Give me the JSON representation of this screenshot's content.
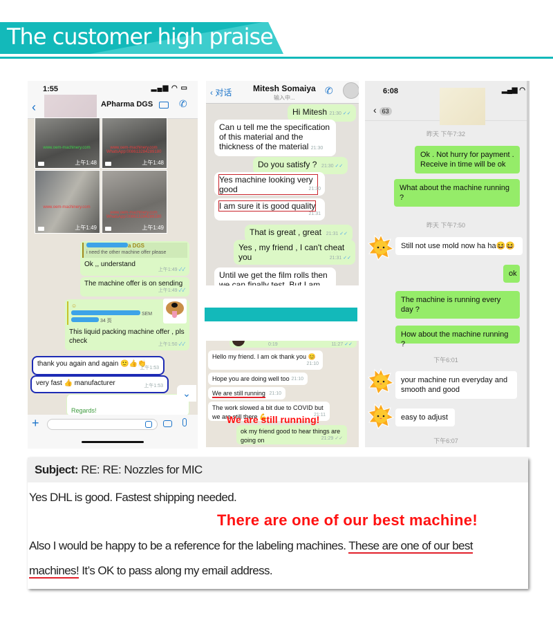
{
  "banner": {
    "title": "The customer high praise",
    "accent": "#13b9ba"
  },
  "whatsapp1": {
    "status_time": "1:55",
    "contact_name": "APharma DGS",
    "photos": [
      {
        "watermark": "www.oem-machinery.com",
        "time": "上午1:48"
      },
      {
        "watermark": "www.oem-machinery.com WhatsApp:008613284289180",
        "time": "上午1:48"
      },
      {
        "watermark": "www.oem-machinery.com",
        "time": "上午1:49"
      },
      {
        "watermark": "www.oem-machinery.com WhatsApp:008613284289180",
        "time": "上午1:49"
      }
    ],
    "quote_name": "a DGS",
    "quote_text": "i need the other machine offer please",
    "messages": [
      {
        "text": "Ok ,, understand",
        "time": "上午1:49"
      },
      {
        "text": "The machine offer is on sending",
        "time": "上午1:49"
      },
      {
        "quote_suffix": "SEM",
        "quote_pages": "34 页",
        "text": "This liquid packing machine offer , pls check",
        "time": "上午1:50"
      },
      {
        "text": "thank you again and again 🙂👍👏",
        "time": "上午1:53"
      },
      {
        "text": "very fast 👍 manufacturer",
        "time": "上午1:53"
      }
    ],
    "regards": "Regards!"
  },
  "whatsapp2": {
    "back_label": "对话",
    "contact_name": "Mitesh Somaiya",
    "status": "输入中...",
    "messages": [
      {
        "text": "Hi Mitesh",
        "time": "21:30",
        "dir": "out"
      },
      {
        "text": "Can u tell me the specification of this material and the thickness of the material",
        "time": "21:30",
        "dir": "in"
      },
      {
        "text": "Do you satisfy  ?",
        "time": "21:30",
        "dir": "out"
      },
      {
        "text": "Yes machine looking very good",
        "time": "21:30",
        "dir": "in"
      },
      {
        "text": "I am sure it is good quality",
        "time": "21:31",
        "dir": "in"
      },
      {
        "text": "That is great , great",
        "time": "21:31",
        "dir": "out"
      },
      {
        "text": "Yes , my friend , I can't cheat you",
        "time": "21:31",
        "dir": "out"
      },
      {
        "text": "Until we get the film rolls then we can finally test. But I am",
        "time": "",
        "dir": "in"
      }
    ]
  },
  "whatsapp3": {
    "voice_duration": "0:19",
    "voice_time": "11:27",
    "messages": [
      {
        "text": "Hello my friend. I am ok thank you 😊",
        "time": "21:10"
      },
      {
        "text": "Hope you are doing well too",
        "time": "21:10"
      },
      {
        "text": "We are still running",
        "time": "21:10"
      },
      {
        "text": "The work slowed a bit due to COVID but we are still there 💪",
        "time": "21:11"
      },
      {
        "text": "ok my friend good to hear things are going on",
        "time": "21:29"
      }
    ],
    "annotation": "We are still running!"
  },
  "wechat": {
    "status_time": "6:08",
    "unread_count": "63",
    "messages": [
      {
        "type": "time",
        "text": "昨天 下午7:32"
      },
      {
        "type": "out",
        "text": "Ok . Not hurry for payment . Receive in time will be ok"
      },
      {
        "type": "out",
        "text": "What about the machine running ?"
      },
      {
        "type": "time",
        "text": "昨天 下午7:50"
      },
      {
        "type": "in",
        "text": "Still not use mold now ha ha😆😆"
      },
      {
        "type": "out",
        "text": "ok"
      },
      {
        "type": "out",
        "text": "The machine is running every day ?"
      },
      {
        "type": "out",
        "text": "How about the machine running ?"
      },
      {
        "type": "time",
        "text": "下午6:01"
      },
      {
        "type": "in",
        "text": "your machine run everyday and smooth and good"
      },
      {
        "type": "in",
        "text": "easy to adjust"
      },
      {
        "type": "time",
        "text": "下午6:07"
      }
    ]
  },
  "email": {
    "subject_label": "Subject:",
    "subject": "RE: RE: Nozzles for MIC",
    "line1": "Yes DHL is good.  Fastest shipping needed.",
    "annotation": "There are one of our best machine!",
    "line2_pre": "Also I would be happy to be a reference for the labeling machines.  ",
    "line2_ul": "These are one of our best",
    "line3_ul": "machines!",
    "line3_post": " It’s OK to pass along my email address."
  }
}
